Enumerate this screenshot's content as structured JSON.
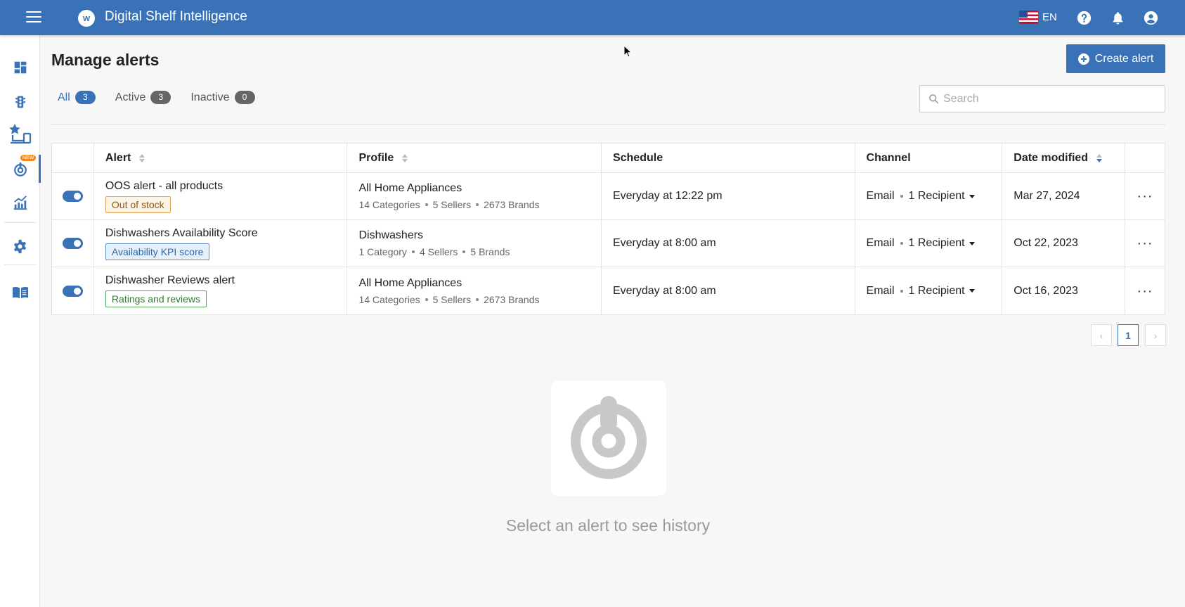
{
  "app": {
    "title": "Digital Shelf Intelligence",
    "logo_letter": "w",
    "language": "EN",
    "brand_color": "#3a72b8"
  },
  "sidebar": {
    "items": [
      {
        "icon": "dashboard-icon"
      },
      {
        "icon": "traffic-light-icon"
      },
      {
        "icon": "star-devices-icon"
      },
      {
        "icon": "alerts-target-icon",
        "badge": "NEW",
        "active": true
      },
      {
        "icon": "trend-chart-icon"
      },
      {
        "icon": "gear-icon"
      },
      {
        "icon": "book-icon"
      }
    ]
  },
  "page": {
    "title": "Manage alerts",
    "create_label": "Create alert",
    "search_placeholder": "Search"
  },
  "filters": [
    {
      "label": "All",
      "count": "3",
      "active": true
    },
    {
      "label": "Active",
      "count": "3",
      "active": false
    },
    {
      "label": "Inactive",
      "count": "0",
      "active": false
    }
  ],
  "table": {
    "headers": {
      "alert": "Alert",
      "profile": "Profile",
      "schedule": "Schedule",
      "channel": "Channel",
      "date": "Date modified"
    },
    "rows": [
      {
        "enabled": true,
        "name": "OOS alert - all products",
        "tag": "Out of stock",
        "tag_color": "#e0a050",
        "profile": "All Home Appliances",
        "meta": [
          "14 Categories",
          "5 Sellers",
          "2673 Brands"
        ],
        "schedule": "Everyday at 12:22 pm",
        "channel": "Email",
        "recipients": "1 Recipient",
        "date": "Mar 27, 2024"
      },
      {
        "enabled": true,
        "name": "Dishwashers Availability Score",
        "tag": "Availability KPI score",
        "tag_color": "#5a92d2",
        "profile": "Dishwashers",
        "meta": [
          "1 Category",
          "4 Sellers",
          "5 Brands"
        ],
        "schedule": "Everyday at 8:00 am",
        "channel": "Email",
        "recipients": "1 Recipient",
        "date": "Oct 22, 2023"
      },
      {
        "enabled": true,
        "name": "Dishwasher Reviews alert",
        "tag": "Ratings and reviews",
        "tag_color": "#52a852",
        "profile": "All Home Appliances",
        "meta": [
          "14 Categories",
          "5 Sellers",
          "2673 Brands"
        ],
        "schedule": "Everyday at 8:00 am",
        "channel": "Email",
        "recipients": "1 Recipient",
        "date": "Oct 16, 2023"
      }
    ]
  },
  "pagination": {
    "prev": "‹",
    "current": "1",
    "next": "›"
  },
  "empty_state": {
    "icon": "alert-target-icon",
    "text": "Select an alert to see history"
  }
}
